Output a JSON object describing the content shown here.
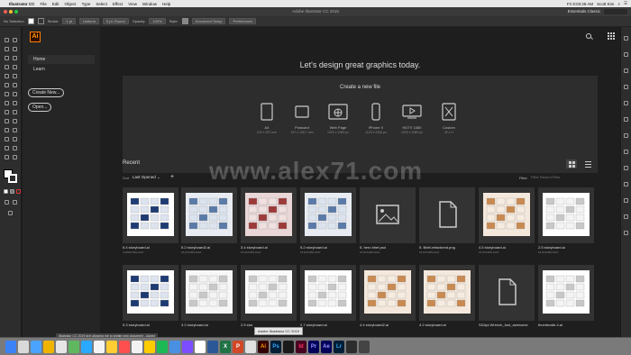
{
  "menubar": {
    "app": "Illustrator CC",
    "items": [
      "File",
      "Edit",
      "Object",
      "Type",
      "Select",
      "Effect",
      "View",
      "Window",
      "Help"
    ],
    "clock": "Fri 8:03:28 AM",
    "user": "Scott Kim"
  },
  "titlebar": {
    "title": "Adobe Illustrator CC 2015",
    "workspace": "Essentials Classic"
  },
  "controlbar": {
    "selection": "No Selection",
    "stroke_label": "Stroke:",
    "stroke_value": "1 pt",
    "uniform": "Uniform",
    "brush": "5 pt. Round",
    "opacity_label": "Opacity:",
    "opacity_value": "100%",
    "style_label": "Style:",
    "doc_setup": "Document Setup",
    "preferences": "Preferences"
  },
  "sidebar": {
    "logo": "Ai",
    "nav": [
      "Home",
      "Learn"
    ],
    "create_btn": "Create New...",
    "open_btn": "Open..."
  },
  "main": {
    "headline": "Let's design great graphics today.",
    "create_title": "Create a new file",
    "presets": [
      {
        "name": "A4",
        "size": "210 x 297 mm",
        "icon": "document-icon"
      },
      {
        "name": "Postcard",
        "size": "197 x 139.7 mm",
        "icon": "postcard-icon"
      },
      {
        "name": "Web Page",
        "size": "1920 x 1080 px",
        "icon": "web-page-icon"
      },
      {
        "name": "iPhone X",
        "size": "1125 x 2436 px",
        "icon": "phone-icon"
      },
      {
        "name": "HDTV 1080",
        "size": "1920 x 1080 px",
        "icon": "video-icon"
      },
      {
        "name": "Custom",
        "size": "W x H",
        "icon": "custom-icon"
      }
    ],
    "recent_title": "Recent",
    "sort_label": "Sort",
    "sort_value": "Last Opened",
    "filter_label": "Filter",
    "filter_placeholder": "Filter Recent Files",
    "files": [
      {
        "name": "5.4 storyboard.ai",
        "time": "4 MINUTES AGO",
        "thumb": "storyboard-blue"
      },
      {
        "name": "5.2 storyboard2.ai",
        "time": "15 HOURS AGO",
        "thumb": "storyboard-grid"
      },
      {
        "name": "3.4 storyboard.ai",
        "time": "15 HOURS AGO",
        "thumb": "storyboard-red"
      },
      {
        "name": "5.2 storyboard.ai",
        "time": "15 HOURS AGO",
        "thumb": "storyboard-grid"
      },
      {
        "name": "5. hero brief.psd",
        "time": "15 HOURS AGO",
        "thumb": "image-placeholder"
      },
      {
        "name": "5. Brief-refactored.png",
        "time": "15 HOURS AGO",
        "thumb": "file-placeholder"
      },
      {
        "name": "4.5 storyboard.ai",
        "time": "15 HOURS AGO",
        "thumb": "storyboard-orange"
      },
      {
        "name": "2.5 storyboard.ai",
        "time": "16 HOURS AGO",
        "thumb": "storyboard-white"
      },
      {
        "name": "5.3 storyboard.ai",
        "time": "",
        "thumb": "storyboard-blue"
      },
      {
        "name": "3.2 storyboard.ai",
        "time": "",
        "thumb": "storyboard-sketch"
      },
      {
        "name": "2.5 stor",
        "time": "",
        "thumb": "storyboard-sketch2"
      },
      {
        "name": "2.7 storyboard.ai",
        "time": "",
        "thumb": "storyboard-white"
      },
      {
        "name": "4.4 storyboard2.ai",
        "time": "",
        "thumb": "storyboard-orange"
      },
      {
        "name": "4.2 storyboard.ai",
        "time": "",
        "thumb": "storyboard-orange"
      },
      {
        "name": "SDApi-Wrench_font_awesome",
        "time": "",
        "thumb": "file-placeholder"
      },
      {
        "name": "thumbnails 4.ai",
        "time": "",
        "thumb": "storyboard-white"
      }
    ]
  },
  "tooltip": "Adobe Illustrator CC 2019",
  "notification": "Illustrator CC 2019 isn't allowing me to create new document - Adobe",
  "watermark": "www.alex71.com",
  "dock": [
    {
      "label": "",
      "color": "#3b82f6",
      "name": "finder-icon"
    },
    {
      "label": "",
      "color": "#d9d9d9",
      "name": "launchpad-icon"
    },
    {
      "label": "",
      "color": "#4aa3ff",
      "name": "safari-icon"
    },
    {
      "label": "",
      "color": "#f0b400",
      "name": "app-icon-1"
    },
    {
      "label": "",
      "color": "#e6e6e6",
      "name": "app-icon-2"
    },
    {
      "label": "",
      "color": "#5fb85f",
      "name": "app-icon-3"
    },
    {
      "label": "",
      "color": "#29a9ff",
      "name": "app-icon-4"
    },
    {
      "label": "",
      "color": "#f4f4f4",
      "name": "app-icon-5"
    },
    {
      "label": "",
      "color": "#ffcc33",
      "name": "app-icon-6"
    },
    {
      "label": "",
      "color": "#ff4f4f",
      "name": "app-icon-7"
    },
    {
      "label": "",
      "color": "#f2f2f2",
      "name": "app-icon-8"
    },
    {
      "label": "",
      "color": "#ffcc00",
      "name": "app-icon-9"
    },
    {
      "label": "",
      "color": "#1db954",
      "name": "app-icon-10"
    },
    {
      "label": "",
      "color": "#4a90e2",
      "name": "app-icon-11"
    },
    {
      "label": "",
      "color": "#7c4dff",
      "name": "app-icon-12"
    },
    {
      "label": "",
      "color": "#ffffff",
      "name": "app-icon-13"
    },
    {
      "label": "",
      "color": "#2b5797",
      "name": "word-icon"
    },
    {
      "label": "X",
      "color": "#217346",
      "name": "excel-icon"
    },
    {
      "label": "P",
      "color": "#d24726",
      "name": "powerpoint-icon"
    },
    {
      "label": "",
      "color": "#e1e1e1",
      "name": "app-icon-14"
    },
    {
      "label": "Ai",
      "color": "#330000",
      "name": "illustrator-icon"
    },
    {
      "label": "Ps",
      "color": "#001e36",
      "name": "photoshop-icon"
    },
    {
      "label": "",
      "color": "#1a1a1a",
      "name": "app-icon-15"
    },
    {
      "label": "Id",
      "color": "#49021f",
      "name": "indesign-icon"
    },
    {
      "label": "Pr",
      "color": "#00005b",
      "name": "premiere-icon"
    },
    {
      "label": "Ae",
      "color": "#00005b",
      "name": "aftereffects-icon"
    },
    {
      "label": "Lr",
      "color": "#001e36",
      "name": "lightroom-icon"
    },
    {
      "label": "",
      "color": "#2d2d2d",
      "name": "app-icon-16"
    },
    {
      "label": "",
      "color": "#444",
      "name": "app-icon-17"
    }
  ]
}
